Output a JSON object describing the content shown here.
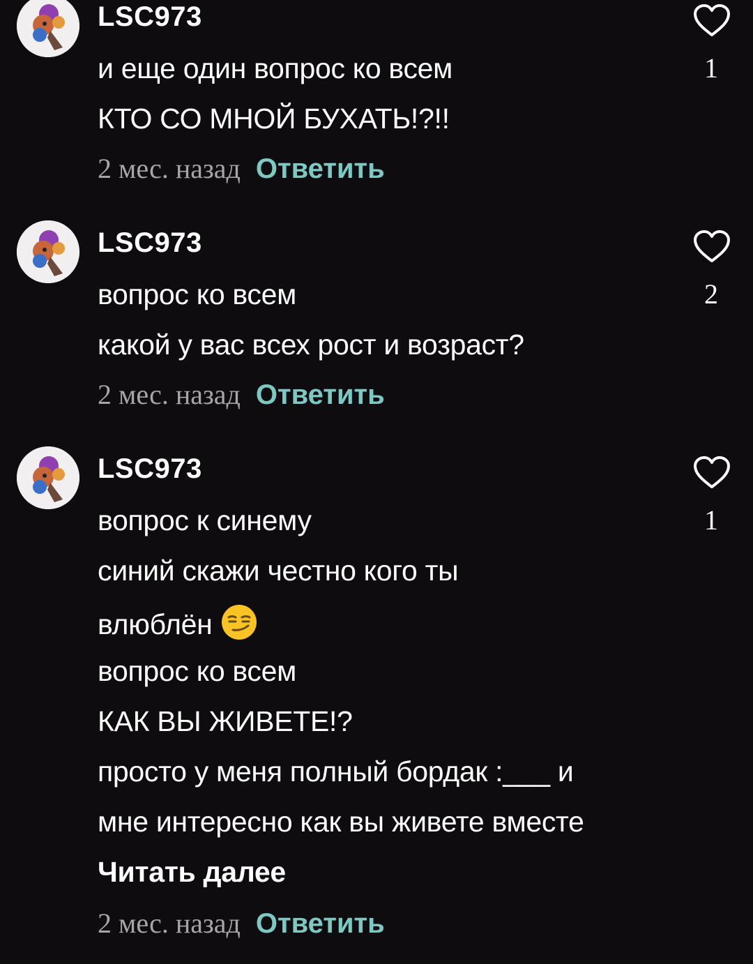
{
  "comments": [
    {
      "username": "LSC973",
      "lines": [
        "и еще один вопрос ко всем",
        "КТО СО МНОЙ БУХАТЬ!?!!"
      ],
      "time": "2 мес. назад",
      "reply_label": "Ответить",
      "like_count": "1",
      "avatar_icon": "user-avatar-image",
      "like_icon": "heart-outline-icon"
    },
    {
      "username": "LSC973",
      "lines": [
        "вопрос ко всем",
        "какой у вас всех рост и возраст?"
      ],
      "time": "2 мес. назад",
      "reply_label": "Ответить",
      "like_count": "2",
      "avatar_icon": "user-avatar-image",
      "like_icon": "heart-outline-icon"
    },
    {
      "username": "LSC973",
      "lines": [
        "вопрос к синему",
        "синий скажи честно кого ты",
        "влюблён",
        "вопрос ко всем",
        "КАК ВЫ ЖИВЕТЕ!?",
        "просто у меня полный бордак :___ и",
        "мне интересно как вы живете вместе"
      ],
      "emoji": "smirking-face-emoji",
      "read_more_label": "Читать далее",
      "time": "2 мес. назад",
      "reply_label": "Ответить",
      "like_count": "1",
      "avatar_icon": "user-avatar-image",
      "like_icon": "heart-outline-icon"
    }
  ],
  "colors": {
    "background": "#0e0c0f",
    "text": "#ffffff",
    "muted": "#a7a5a8",
    "accent": "#7ec8c4"
  }
}
